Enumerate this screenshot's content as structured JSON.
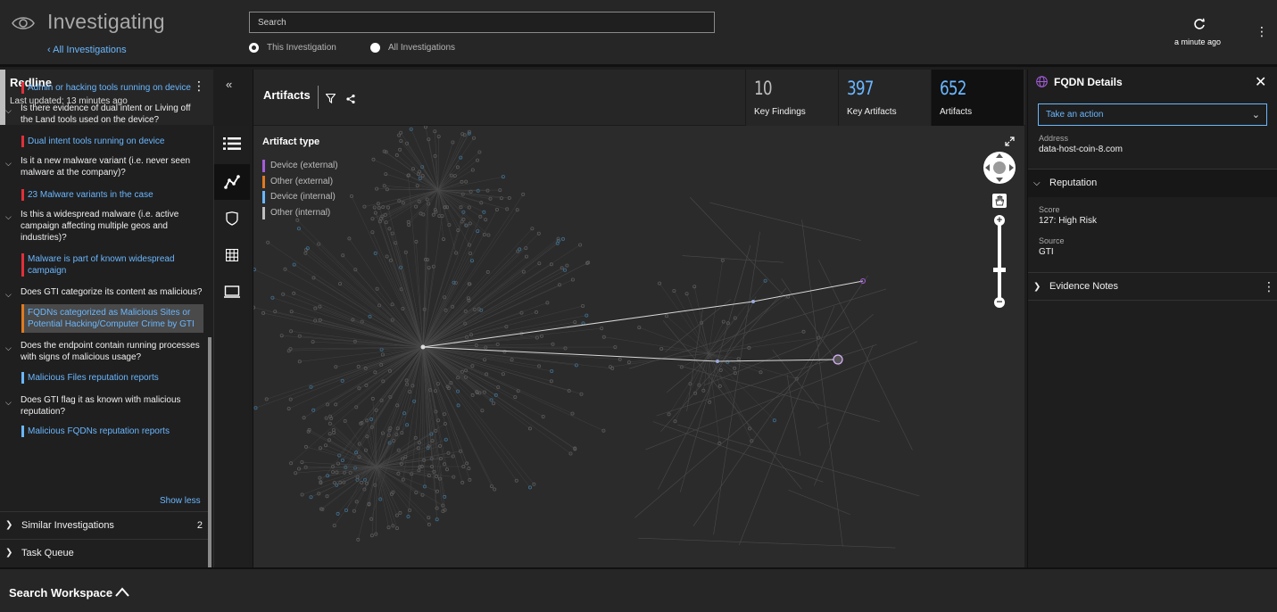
{
  "app": {
    "title": "Investigating",
    "back_link": "‹ All Investigations"
  },
  "search": {
    "placeholder": "Search",
    "scope_options": [
      "This Investigation",
      "All Investigations"
    ],
    "selected_scope": "This Investigation"
  },
  "refresh": {
    "time": "a minute ago"
  },
  "left_panel": {
    "title": "Redline",
    "updated": "Last updated: 13 minutes ago",
    "items": [
      {
        "type": "link",
        "text": "Admin or hacking tools running on device",
        "color": "#e0303a"
      },
      {
        "type": "question",
        "text": "Is there evidence of dual intent or Living off the Land tools used on the device?"
      },
      {
        "type": "link",
        "text": "Dual intent tools running on device",
        "color": "#e0303a"
      },
      {
        "type": "question",
        "text": "Is it a new malware variant (i.e. never seen malware at the company)?"
      },
      {
        "type": "link",
        "text": "23 Malware variants in the case",
        "color": "#e0303a"
      },
      {
        "type": "question",
        "text": "Is this a widespread malware (i.e. active campaign affecting multiple geos and industries)?"
      },
      {
        "type": "link",
        "text": "Malware is part of known widespread campaign",
        "color": "#e0303a"
      },
      {
        "type": "question",
        "text": "Does GTI categorize its content as malicious?"
      },
      {
        "type": "link",
        "text": "FQDNs categorized as Malicious Sites or Potential Hacking/Computer Crime by GTI",
        "color": "#e07a20"
      },
      {
        "type": "question",
        "text": "Does the endpoint contain running processes with signs of malicious usage?"
      },
      {
        "type": "link",
        "text": "Malicious Files reputation reports",
        "color": "#6ab7ff"
      },
      {
        "type": "question",
        "text": "Does GTI flag it as known with malicious reputation?"
      },
      {
        "type": "link",
        "text": "Malicious FQDNs reputation reports",
        "color": "#6ab7ff"
      }
    ],
    "show_less": "Show less",
    "sections": [
      {
        "label": "Similar Investigations",
        "count": "2"
      },
      {
        "label": "Task Queue",
        "count": ""
      }
    ]
  },
  "center": {
    "title": "Artifacts",
    "stats": [
      {
        "value": "10",
        "label": "Key Findings",
        "color": "#bdbdbd"
      },
      {
        "value": "397",
        "label": "Key Artifacts",
        "color": "#6ab7ff"
      },
      {
        "value": "652",
        "label": "Artifacts",
        "color": "#6ab7ff"
      }
    ],
    "legend_title": "Artifact type",
    "legend": [
      {
        "label": "Device (external)",
        "color": "#a45dd9"
      },
      {
        "label": "Other (external)",
        "color": "#e07a20"
      },
      {
        "label": "Device (internal)",
        "color": "#6ab7ff"
      },
      {
        "label": "Other (internal)",
        "color": "#bdbdbd"
      }
    ]
  },
  "right_panel": {
    "title": "FQDN Details",
    "action": "Take an action",
    "address_label": "Address",
    "address_value": "data-host-coin-8.com",
    "reputation_label": "Reputation",
    "score_label": "Score",
    "score_value": "127: High Risk",
    "source_label": "Source",
    "source_value": "GTI",
    "evidence_label": "Evidence Notes"
  },
  "bottom": {
    "label": "Search Workspace"
  }
}
